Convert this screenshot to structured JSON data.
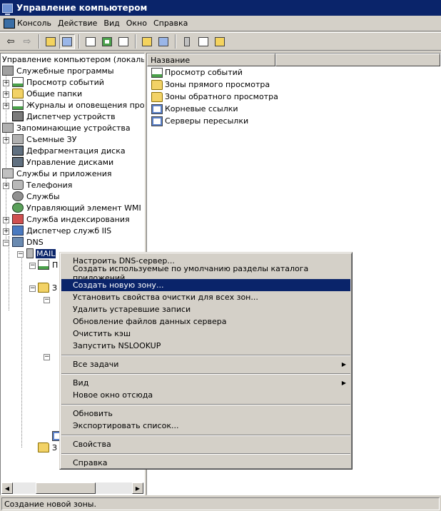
{
  "window": {
    "title": "Управление компьютером"
  },
  "menu": [
    {
      "label": "Консоль"
    },
    {
      "label": "Действие"
    },
    {
      "label": "Вид"
    },
    {
      "label": "Окно"
    },
    {
      "label": "Справка"
    }
  ],
  "toolbar": {
    "buttons": [
      "back-arrow-icon",
      "forward-arrow-icon",
      "up-folder-icon",
      "show-tree-icon",
      "properties-icon",
      "refresh-icon",
      "export-list-icon",
      "help-icon",
      "show-hide-action-pane-icon",
      "server-icon",
      "list-icon",
      "folder-icon"
    ]
  },
  "tree": {
    "root": "Управление компьютером (локальным)",
    "system_tools": "Служебные программы",
    "event_viewer": "Просмотр событий",
    "shared_folders": "Общие папки",
    "logs_alerts": "Журналы и оповещения производительности",
    "device_manager": "Диспетчер устройств",
    "storage": "Запоминающие устройства",
    "removable": "Съемные ЗУ",
    "defrag": "Дефрагментация диска",
    "disk_mgmt": "Управление дисками",
    "services_apps": "Службы и приложения",
    "telephony": "Телефония",
    "services": "Службы",
    "wmi": "Управляющий элемент WMI",
    "indexing": "Служба индексирования",
    "iis": "Диспетчер служб IIS",
    "dns": "DNS",
    "mail": "MAIL",
    "child_1": "П",
    "child_2": "З",
    "child_3": "З"
  },
  "list": {
    "column": "Название",
    "items": [
      {
        "label": "Просмотр событий",
        "icon": "event-log-icon"
      },
      {
        "label": "Зоны прямого просмотра",
        "icon": "folder-icon"
      },
      {
        "label": "Зоны обратного просмотра",
        "icon": "folder-icon"
      },
      {
        "label": "Корневые ссылки",
        "icon": "dns-record-icon"
      },
      {
        "label": "Серверы пересылки",
        "icon": "dns-record-icon"
      }
    ]
  },
  "context_menu": {
    "configure": "Настроить DNS-сервер...",
    "create_partitions": "Создать используемые по умолчанию разделы каталога приложений...",
    "new_zone": "Создать новую зону...",
    "scavenging": "Установить свойства очистки для всех зон...",
    "scavenge_stale": "Удалить устаревшие записи",
    "update_files": "Обновление файлов данных сервера",
    "clear_cache": "Очистить кэш",
    "nslookup": "Запустить NSLOOKUP",
    "all_tasks": "Все задачи",
    "view": "Вид",
    "new_window": "Новое окно отсюда",
    "refresh": "Обновить",
    "export": "Экспортировать список...",
    "properties": "Свойства",
    "help": "Справка"
  },
  "status": {
    "text": "Создание новой зоны."
  },
  "colors": {
    "title_bar": "#0a246a",
    "face": "#d4d0c8",
    "highlight": "#0a246a"
  }
}
